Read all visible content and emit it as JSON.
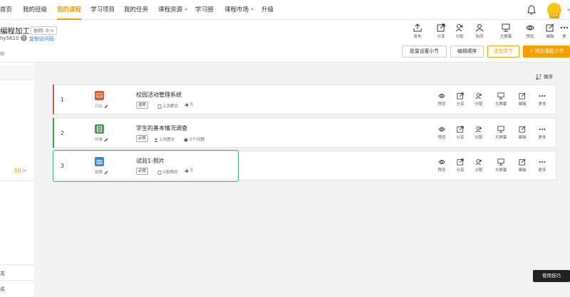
{
  "nav": {
    "items": [
      {
        "label": "首页",
        "active": false
      },
      {
        "label": "我的班级",
        "active": false
      },
      {
        "label": "我的课程",
        "active": true
      },
      {
        "label": "学习项目",
        "active": false
      },
      {
        "label": "我的任务",
        "active": false
      },
      {
        "label": "课程资源",
        "active": false,
        "dropdown": true
      },
      {
        "label": "学习圈",
        "active": false
      },
      {
        "label": "课程市场",
        "active": false,
        "dropdown": true
      },
      {
        "label": "升级",
        "active": false
      }
    ],
    "level_badge": "LV.4"
  },
  "course": {
    "title": "编程加工",
    "collab_badge": "协同: 0 >",
    "code": "hy5610",
    "help": "?",
    "copy_code": "复制访问码",
    "sub_label": "布"
  },
  "toolbar": [
    {
      "label": "发布",
      "icon": "publish-icon"
    },
    {
      "label": "分享",
      "icon": "share-icon"
    },
    {
      "label": "分配",
      "icon": "assign-icon"
    },
    {
      "label": "协同",
      "icon": "collab-icon"
    },
    {
      "label": "大屏幕",
      "icon": "screen-icon"
    },
    {
      "label": "预览",
      "icon": "eye-icon"
    },
    {
      "label": "编辑",
      "icon": "edit-icon"
    },
    {
      "label": "更",
      "icon": "more-icon"
    }
  ],
  "actions": {
    "batch": "批量设置小节",
    "order": "编辑顺序",
    "add_chapter": "添加章节",
    "add_section": "+ 添加课程小节"
  },
  "sidebar": {
    "count": "36",
    "chev": ">",
    "item_1": "志",
    "item_2": "劣"
  },
  "sort_label": "倒序",
  "colors": {
    "accent": "#f5a000",
    "selected": "#3cb97a"
  },
  "sections": [
    {
      "num": "1",
      "type": "讨论",
      "type_color": "#e8542c",
      "bar_color": "#d9534f",
      "title": "校园活动管理系统",
      "tag": "选修",
      "meta_1": "1次提交",
      "meta_2": "0"
    },
    {
      "num": "2",
      "type": "问卷",
      "type_color": "#2ea94b",
      "bar_color": "#2ea94b",
      "title": "学生的基本情况调查",
      "tag": "必修",
      "meta_1": "1次提交",
      "meta_2": "5个问题"
    },
    {
      "num": "3",
      "type": "拍照",
      "type_color": "#2f8ae5",
      "bar_color": "",
      "title": "试验1-照片",
      "tag": "必修",
      "meta_1": "0张照片",
      "meta_2": "0"
    }
  ],
  "row_actions": [
    "预览",
    "分享",
    "分配",
    "大屏幕",
    "编辑",
    "更多"
  ],
  "tips": "使用技巧"
}
